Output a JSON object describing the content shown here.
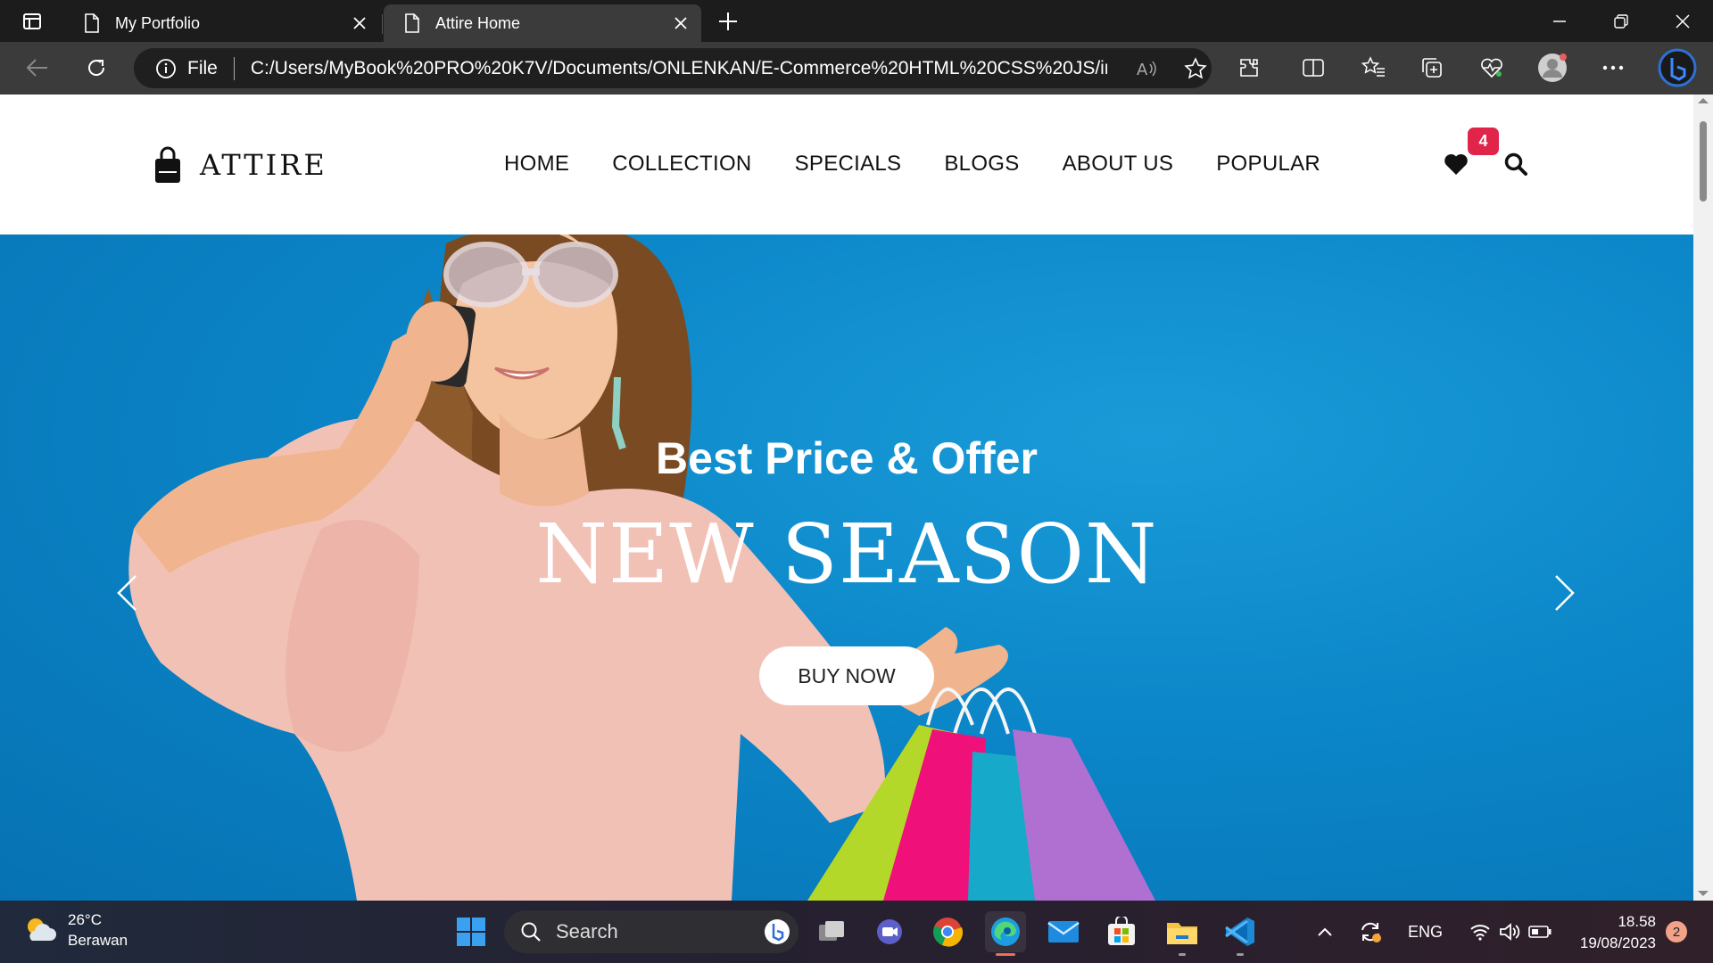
{
  "browser": {
    "tabs": [
      {
        "title": "My Portfolio",
        "active": false
      },
      {
        "title": "Attire Home",
        "active": true
      }
    ],
    "address": {
      "scheme_label": "File",
      "url": "C:/Users/MyBook%20PRO%20K7V/Documents/ONLENKAN/E-Commerce%20HTML%20CSS%20JS/in..."
    },
    "icons": [
      "tab-actions-icon",
      "page-icon",
      "close-icon",
      "new-tab-icon",
      "minimize-icon",
      "restore-icon",
      "close-window-icon",
      "back-icon",
      "refresh-icon",
      "info-icon",
      "read-aloud-icon",
      "favorite-star-icon",
      "extensions-icon",
      "split-screen-icon",
      "favorites-icon",
      "collections-icon",
      "browser-essentials-icon",
      "profile-icon",
      "more-icon",
      "copilot-icon"
    ]
  },
  "site": {
    "logo_text": "ATTIRE",
    "nav": [
      "HOME",
      "COLLECTION",
      "SPECIALS",
      "BLOGS",
      "ABOUT US",
      "POPULAR"
    ],
    "wishlist_count": "4",
    "hero": {
      "subtitle": "Best Price & Offer",
      "title": "NEW SEASON",
      "button": "BUY NOW"
    }
  },
  "taskbar": {
    "weather": {
      "temp": "26°C",
      "condition": "Berawan"
    },
    "search_placeholder": "Search",
    "language": "ENG",
    "time": "18.58",
    "date": "19/08/2023",
    "notifications": "2"
  },
  "colors": {
    "hero_blue": "#0b86c8",
    "badge_red": "#e0244a",
    "browser_dark": "#3b3b3b"
  }
}
